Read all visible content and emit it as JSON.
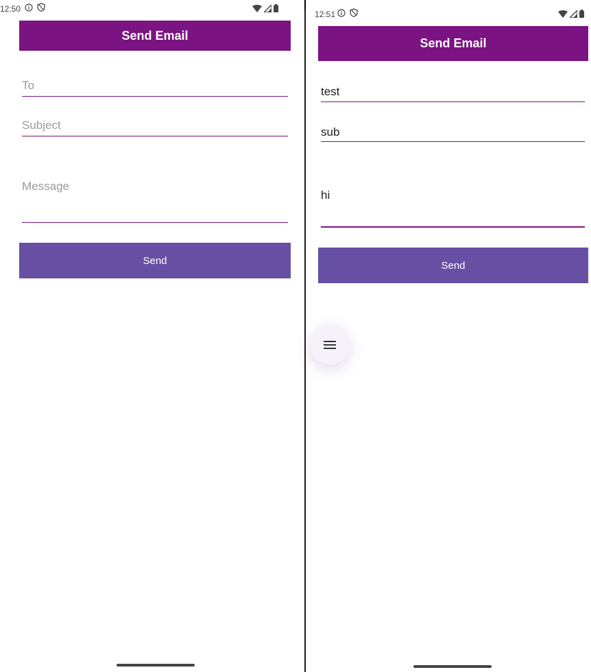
{
  "left": {
    "status": {
      "time": "12:50"
    },
    "app_bar": {
      "title": "Send Email"
    },
    "form": {
      "to_placeholder": "To",
      "subject_placeholder": "Subject",
      "message_placeholder": "Message",
      "send_label": "Send"
    }
  },
  "right": {
    "status": {
      "time": "12:51"
    },
    "app_bar": {
      "title": "Send Email"
    },
    "form": {
      "to_value": "test",
      "subject_value": "sub",
      "message_value": "hi",
      "send_label": "Send"
    }
  },
  "colors": {
    "app_bar": "#7b1482",
    "button": "#6750a4",
    "underline": "#7b1482"
  },
  "icons": [
    "info-icon",
    "shield-icon",
    "wifi-icon",
    "signal-icon",
    "battery-icon",
    "menu-icon"
  ]
}
